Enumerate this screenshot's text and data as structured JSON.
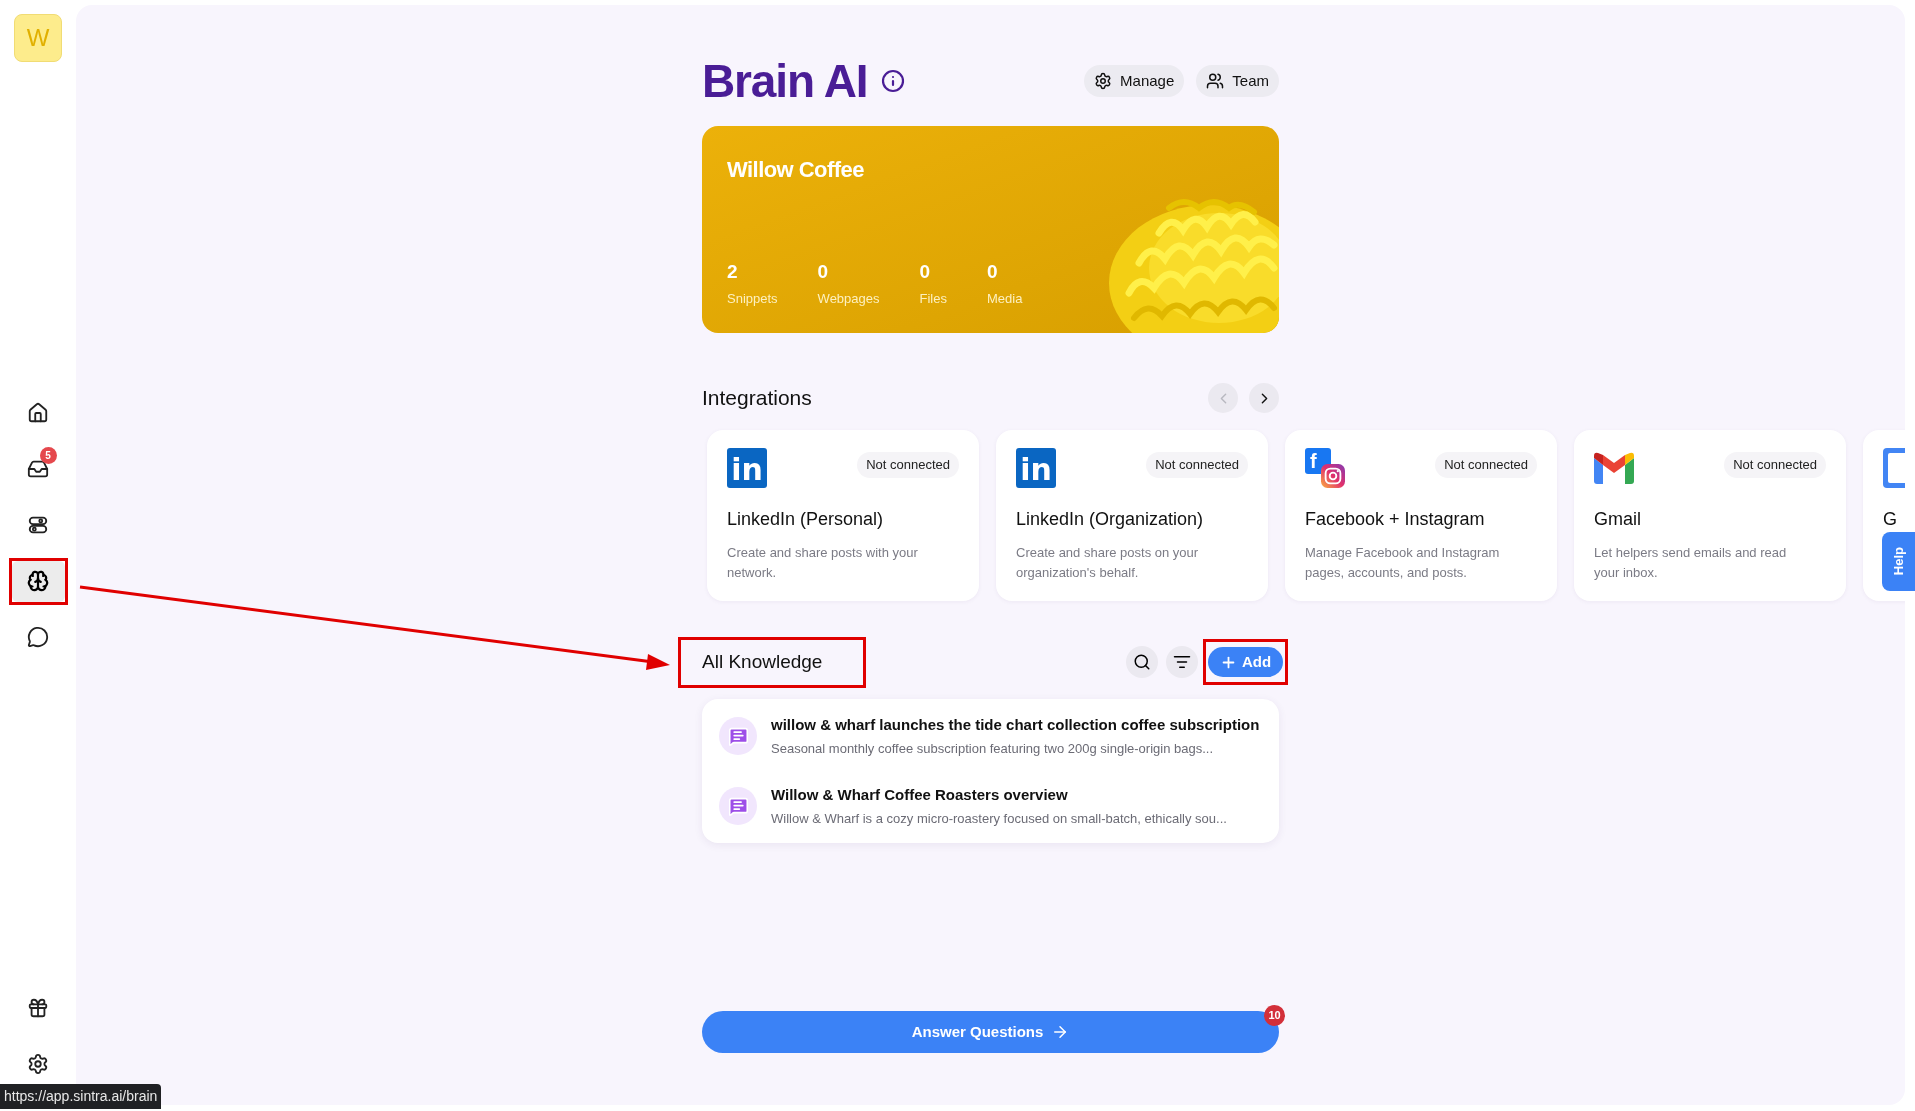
{
  "sidebar": {
    "logo": "W",
    "items": [
      {
        "selected": false,
        "highlighted": false
      },
      {
        "selected": false,
        "highlighted": false,
        "badge": "5"
      },
      {
        "selected": false,
        "highlighted": false
      },
      {
        "selected": true,
        "highlighted": true
      },
      {
        "selected": false,
        "highlighted": false
      }
    ],
    "bottom_items": [
      {
        "selected": false
      },
      {
        "selected": false
      }
    ]
  },
  "header": {
    "title": "Brain AI",
    "buttons": [
      "Manage",
      "Team"
    ]
  },
  "banner": {
    "title": "Willow Coffee",
    "stats": [
      {
        "value": "2",
        "label": "Snippets"
      },
      {
        "value": "0",
        "label": "Webpages"
      },
      {
        "value": "0",
        "label": "Files"
      },
      {
        "value": "0",
        "label": "Media"
      }
    ]
  },
  "integrations": {
    "title": "Integrations",
    "prev": {
      "disabled": true
    },
    "next": {
      "disabled": false
    },
    "cards": [
      {
        "kind": "linkedin",
        "logo_text": "in",
        "status": "Not connected",
        "name": "LinkedIn (Personal)",
        "description": "Create and share posts with your network."
      },
      {
        "kind": "linkedin",
        "logo_text": "in",
        "status": "Not connected",
        "name": "LinkedIn (Organization)",
        "description": "Create and share posts on your organization's behalf."
      },
      {
        "kind": "meta",
        "logo_text": "f",
        "status": "Not connected",
        "name": "Facebook + Instagram",
        "description": "Manage Facebook and Instagram pages, accounts, and posts."
      },
      {
        "kind": "gmail",
        "status": "Not connected",
        "name": "Gmail",
        "description": "Let helpers send emails and read your inbox."
      },
      {
        "kind": "calendar",
        "name": "G"
      }
    ]
  },
  "knowledge": {
    "title": "All Knowledge",
    "title_highlighted": true,
    "add_button": "Add",
    "add_highlighted": true,
    "items": [
      {
        "title": "willow & wharf launches the tide chart collection coffee subscription",
        "snippet": "Seasonal monthly coffee subscription featuring two 200g single-origin bags..."
      },
      {
        "title": "Willow & Wharf Coffee Roasters overview",
        "snippet": "Willow & Wharf is a cozy micro-roastery focused on small-batch, ethically sou..."
      }
    ]
  },
  "answer_button": {
    "label": "Answer Questions",
    "badge": "10"
  },
  "help_tab": "Help",
  "status_url": "https://app.sintra.ai/brain"
}
